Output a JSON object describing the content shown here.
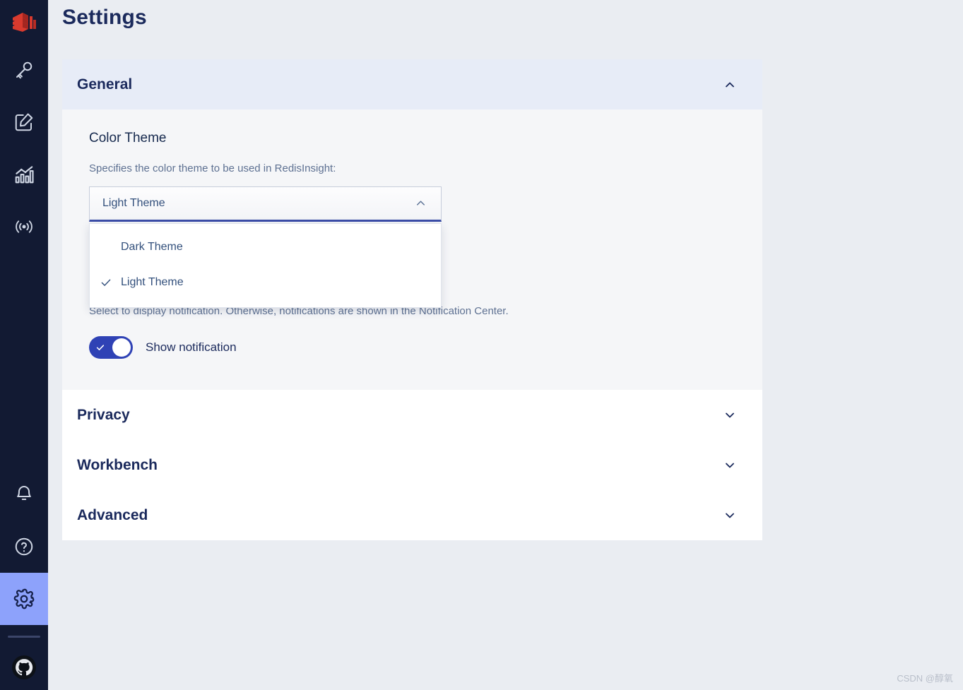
{
  "app": {
    "logo": "redis-logo",
    "watermark": "CSDN @醇氧"
  },
  "sidebar": {
    "items": [
      {
        "name": "browser",
        "icon": "key-icon"
      },
      {
        "name": "workbench",
        "icon": "edit-square-icon"
      },
      {
        "name": "analysis-tools",
        "icon": "bar-chart-icon"
      },
      {
        "name": "pub-sub",
        "icon": "broadcast-icon"
      }
    ],
    "bottom_items": [
      {
        "name": "notifications",
        "icon": "bell-icon",
        "active": false
      },
      {
        "name": "help",
        "icon": "question-circle-icon",
        "active": false
      },
      {
        "name": "settings",
        "icon": "gear-icon",
        "active": true
      }
    ],
    "github": {
      "name": "github",
      "icon": "github-icon"
    }
  },
  "header": {
    "title": "Settings"
  },
  "sections": [
    {
      "id": "general",
      "title": "General",
      "expanded": true,
      "chevron": "chevron-up-icon"
    },
    {
      "id": "privacy",
      "title": "Privacy",
      "expanded": false,
      "chevron": "chevron-down-icon"
    },
    {
      "id": "workbench",
      "title": "Workbench",
      "expanded": false,
      "chevron": "chevron-down-icon"
    },
    {
      "id": "advanced",
      "title": "Advanced",
      "expanded": false,
      "chevron": "chevron-down-icon"
    }
  ],
  "general": {
    "color_theme": {
      "title": "Color Theme",
      "description": "Specifies the color theme to be used in RedisInsight:",
      "selected": "Light Theme",
      "open": true,
      "chevron": "chevron-up-icon",
      "options": [
        {
          "label": "Dark Theme",
          "checked": false
        },
        {
          "label": "Light Theme",
          "checked": true
        }
      ]
    },
    "notifications": {
      "description": "Select to display notification. Otherwise, notifications are shown in the Notification Center.",
      "toggle_label": "Show notification",
      "toggle_on": true
    }
  },
  "colors": {
    "sidebar_bg": "#121a33",
    "sidebar_active": "#8da2fb",
    "page_bg": "#eaedf2",
    "accordion_open_bg": "#e7ecf7",
    "card_bg": "#ffffff",
    "body_bg": "#f5f6f8",
    "accent": "#2f42b5",
    "focus_underline": "#3b4ea8",
    "title_color": "#1b2a5c",
    "muted_text": "#5e7192",
    "redis_red": "#c6302b"
  }
}
